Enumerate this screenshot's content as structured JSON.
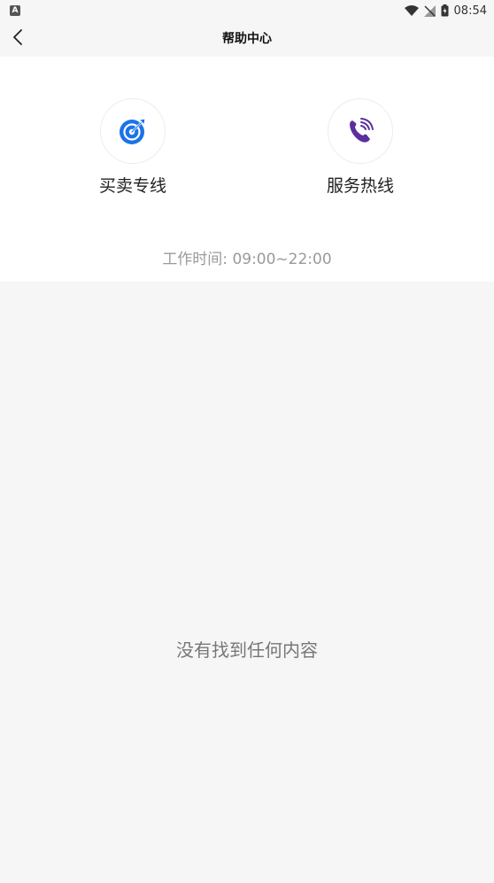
{
  "status_bar": {
    "left_icon_glyph": "A",
    "time": "08:54",
    "icons": [
      "wifi-icon",
      "signal-off-icon",
      "battery-charging-icon"
    ]
  },
  "nav": {
    "title": "帮助中心",
    "back_icon": "chevron-left-icon"
  },
  "contacts": [
    {
      "label": "买卖专线",
      "icon": "target-icon",
      "color": "#1a73e8"
    },
    {
      "label": "服务热线",
      "icon": "phone-icon",
      "color": "#5b2fa0"
    }
  ],
  "work_hours": "工作时间: 09:00~22:00",
  "empty_state": {
    "message": "没有找到任何内容"
  },
  "colors": {
    "background": "#f6f6f6",
    "panel": "#ffffff",
    "primary_blue": "#1a73e8",
    "purple": "#5b2fa0"
  }
}
